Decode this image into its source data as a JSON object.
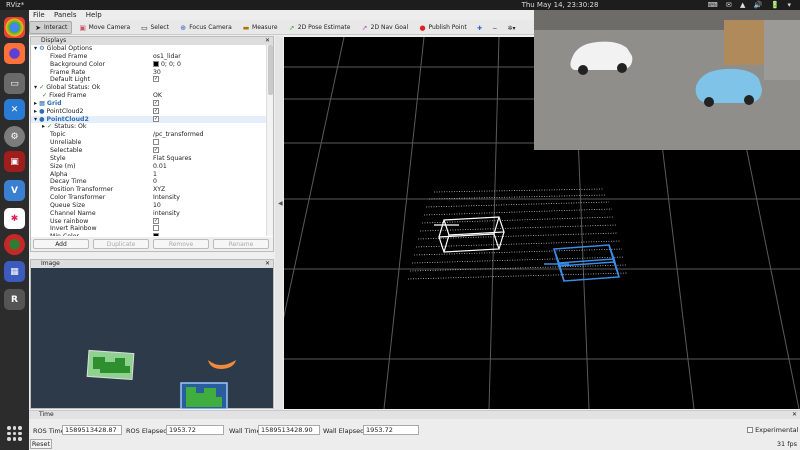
{
  "system": {
    "app_title": "RViz*",
    "clock": "Thu May 14, 23:30:28",
    "tray": "⌨ ✉ ▲ 🔊 🔋 ▾"
  },
  "dock": {
    "apps": [
      "chrome",
      "firefox",
      "files",
      "vscode",
      "settings",
      "terminal",
      "vscode2",
      "slack",
      "update",
      "app",
      "rviz"
    ]
  },
  "menu": {
    "file": "File",
    "panels": "Panels",
    "help": "Help"
  },
  "toolbar": {
    "interact": "Interact",
    "move_camera": "Move Camera",
    "select": "Select",
    "focus_camera": "Focus Camera",
    "measure": "Measure",
    "pose_estimate": "2D Pose Estimate",
    "nav_goal": "2D Nav Goal",
    "publish_point": "Publish Point"
  },
  "displays": {
    "title": "Displays",
    "rows": [
      {
        "indent": 0,
        "label": "Global Options",
        "value": "",
        "arrow": "▾",
        "icon": "⚙"
      },
      {
        "indent": 2,
        "label": "Fixed Frame",
        "value": "os1_lidar"
      },
      {
        "indent": 2,
        "label": "Background Color",
        "value": "0; 0; 0",
        "swatch": "#000000"
      },
      {
        "indent": 2,
        "label": "Frame Rate",
        "value": "30"
      },
      {
        "indent": 2,
        "label": "Default Light",
        "value": "",
        "check": true
      },
      {
        "indent": 0,
        "label": "Global Status: Ok",
        "value": "",
        "arrow": "▾",
        "icon": "✓"
      },
      {
        "indent": 1,
        "label": "Fixed Frame",
        "value": "OK",
        "icon": "✓"
      },
      {
        "indent": 0,
        "label": "Grid",
        "value": "",
        "arrow": "▸",
        "icon": "▦",
        "blue": true,
        "check": true
      },
      {
        "indent": 0,
        "label": "PointCloud2",
        "value": "",
        "arrow": "▸",
        "icon": "●",
        "check": true
      },
      {
        "indent": 0,
        "label": "PointCloud2",
        "value": "",
        "arrow": "▾",
        "icon": "●",
        "blue": true,
        "check": true
      },
      {
        "indent": 1,
        "label": "Status: Ok",
        "value": "",
        "arrow": "▸",
        "icon": "✓"
      },
      {
        "indent": 2,
        "label": "Topic",
        "value": "/pc_transformed"
      },
      {
        "indent": 2,
        "label": "Unreliable",
        "value": "",
        "check": false
      },
      {
        "indent": 2,
        "label": "Selectable",
        "value": "",
        "check": true
      },
      {
        "indent": 2,
        "label": "Style",
        "value": "Flat Squares"
      },
      {
        "indent": 2,
        "label": "Size (m)",
        "value": "0.01"
      },
      {
        "indent": 2,
        "label": "Alpha",
        "value": "1"
      },
      {
        "indent": 2,
        "label": "Decay Time",
        "value": "0"
      },
      {
        "indent": 2,
        "label": "Position Transformer",
        "value": "XYZ"
      },
      {
        "indent": 2,
        "label": "Color Transformer",
        "value": "Intensity"
      },
      {
        "indent": 2,
        "label": "Queue Size",
        "value": "10"
      },
      {
        "indent": 2,
        "label": "Channel Name",
        "value": "intensity"
      },
      {
        "indent": 2,
        "label": "Use rainbow",
        "value": "",
        "check": true
      },
      {
        "indent": 2,
        "label": "Invert Rainbow",
        "value": "",
        "check": false
      },
      {
        "indent": 2,
        "label": "Min Color",
        "value": "",
        "swatch": "#000000"
      }
    ],
    "buttons": {
      "add": "Add",
      "duplicate": "Duplicate",
      "remove": "Remove",
      "rename": "Rename"
    }
  },
  "image_panel": {
    "title": "Image"
  },
  "time": {
    "title": "Time",
    "ros_time_label": "ROS Time:",
    "ros_time": "1589513428.87",
    "ros_elapsed_label": "ROS Elapsed:",
    "ros_elapsed": "1953.72",
    "wall_time_label": "Wall Time:",
    "wall_time": "1589513428.90",
    "wall_elapsed_label": "Wall Elapsed:",
    "wall_elapsed": "1953.72",
    "experimental": "Experimental",
    "reset": "Reset",
    "fps": "31 fps"
  },
  "colors": {
    "box_white": "#ffffff",
    "box_blue": "#3a8ee6",
    "detect_green": "#3fae3f",
    "detect_orange": "#f08a3c"
  }
}
